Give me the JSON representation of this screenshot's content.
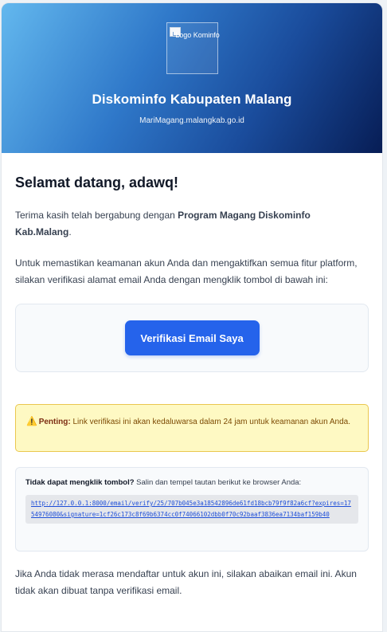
{
  "header": {
    "logo_alt": "Logo Kominfo",
    "title": "Diskominfo Kabupaten Malang",
    "subtitle": "MariMagang.malangkab.go.id"
  },
  "greeting": "Selamat datang, adawq!",
  "intro": {
    "prefix": "Terima kasih telah bergabung dengan ",
    "program": "Program Magang Diskominfo Kab.Malang",
    "suffix": "."
  },
  "instructions": "Untuk memastikan keamanan akun Anda dan mengaktifkan semua fitur platform, silakan verifikasi alamat email Anda dengan mengklik tombol di bawah ini:",
  "verify_button": "Verifikasi Email Saya",
  "warning": {
    "icon": "warning-icon",
    "label": "Penting:",
    "text": " Link verifikasi ini akan kedaluwarsa dalam 24 jam untuk keamanan akun Anda."
  },
  "fallback": {
    "label": "Tidak dapat mengklik tombol?",
    "text": " Salin dan tempel tautan berikut ke browser Anda:",
    "link": "http://127.0.0.1:8000/email/verify/25/707b045e3a18542896de61fd18bcb79f9f82a6cf?expires=1754976080&signature=1cf26c173c8f69b6374cc0f74066102dbb0f70c92baaf3836ea7134baf159b40"
  },
  "footer": "Jika Anda tidak merasa mendaftar untuk akun ini, silakan abaikan email ini. Akun tidak akan dibuat tanpa verifikasi email."
}
